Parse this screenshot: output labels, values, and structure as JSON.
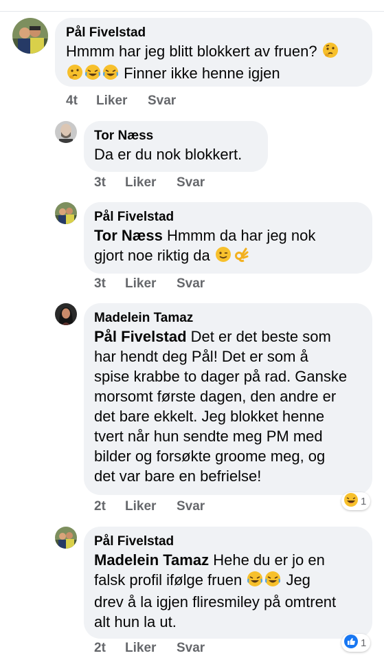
{
  "comments": [
    {
      "author": "Pål Fivelstad",
      "text_1": "Hmmm har jeg blitt blokkert av fruen?",
      "text_2": "Finner ikke henne igjen",
      "time": "4t",
      "like": "Liker",
      "reply": "Svar"
    },
    {
      "author": "Tor Næss",
      "text_1": "Da er du nok blokkert.",
      "time": "3t",
      "like": "Liker",
      "reply": "Svar"
    },
    {
      "author": "Pål Fivelstad",
      "mention": "Tor Næss",
      "text_1": " Hmmm da har jeg nok",
      "text_2": "gjort noe riktig da",
      "time": "3t",
      "like": "Liker",
      "reply": "Svar"
    },
    {
      "author": "Madelein Tamaz",
      "mention": "Pål Fivelstad",
      "text_1": " Det er det beste som",
      "lines": [
        "har hendt deg Pål! Det er som å",
        "spise krabbe to dager på rad. Ganske",
        "morsomt første dagen, den andre er",
        "det bare ekkelt. Jeg blokket henne",
        "tvert når hun sendte meg PM med",
        "bilder og forsøkte groome meg, og",
        "det var bare en befrielse!"
      ],
      "time": "2t",
      "like": "Liker",
      "reply": "Svar",
      "reaction_count": "1",
      "reaction_icon": "laugh-reaction-icon"
    },
    {
      "author": "Pål Fivelstad",
      "mention": "Madelein Tamaz",
      "text_1": " Hehe du er jo en",
      "text_2": "falsk profil ifølge fruen",
      "text_2b": " Jeg",
      "text_3": "drev å la igjen fliresmiley på omtrent",
      "text_4": "alt hun la ut.",
      "time": "2t",
      "like": "Liker",
      "reply": "Svar",
      "reaction_count": "1",
      "reaction_icon": "like-reaction-icon"
    }
  ]
}
